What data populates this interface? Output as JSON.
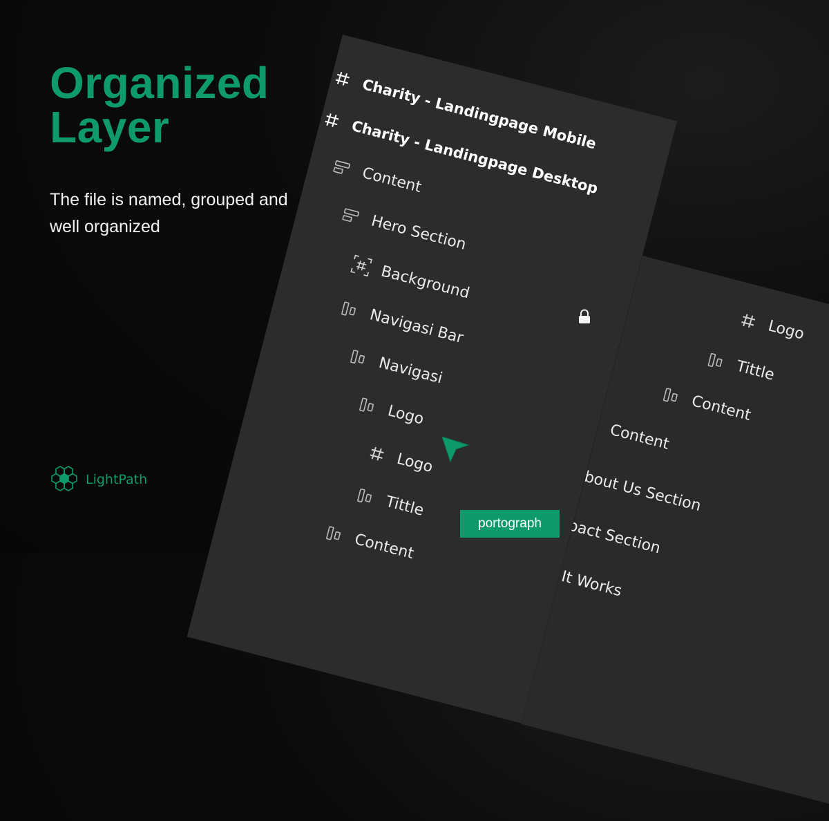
{
  "headline": {
    "line1": "Organized",
    "line2": "Layer"
  },
  "description": "The file is named, grouped and well organized",
  "brand": {
    "name": "LightPath",
    "icon": "hexagon-cluster-icon",
    "color": "#0e9a69"
  },
  "front_panel": {
    "layers": [
      {
        "label": "Charity - Landingpage Mobile",
        "icon": "frame-hash-icon"
      },
      {
        "label": "Charity - Landingpage Desktop",
        "icon": "frame-hash-icon"
      },
      {
        "label": "Content",
        "icon": "auto-layout-vertical-icon"
      },
      {
        "label": "Hero Section",
        "icon": "auto-layout-vertical-icon"
      },
      {
        "label": "Background",
        "icon": "frame-selection-icon"
      },
      {
        "label": "Navigasi Bar",
        "icon": "auto-layout-horizontal-icon"
      },
      {
        "label": "Navigasi",
        "icon": "auto-layout-horizontal-icon"
      },
      {
        "label": "Logo",
        "icon": "auto-layout-horizontal-icon"
      },
      {
        "label": "Logo",
        "icon": "frame-hash-icon"
      },
      {
        "label": "Tittle",
        "icon": "auto-layout-horizontal-icon"
      },
      {
        "label": "Content",
        "icon": "auto-layout-horizontal-icon"
      }
    ]
  },
  "back_panel": {
    "layers": [
      {
        "label": "Logo",
        "icon": "frame-hash-icon"
      },
      {
        "label": "Tittle",
        "icon": "auto-layout-horizontal-icon"
      },
      {
        "label": "Content",
        "icon": "auto-layout-horizontal-icon"
      },
      {
        "label": "Content",
        "icon": "auto-layout-vertical-icon"
      },
      {
        "label": "About Us Section",
        "icon": "auto-layout-vertical-icon"
      },
      {
        "label": "Impact Section",
        "icon": "auto-layout-vertical-icon"
      },
      {
        "label": "How It Works",
        "icon": "auto-layout-vertical-icon"
      }
    ]
  },
  "watermark": "portograph",
  "colors": {
    "accent": "#0e9a69",
    "panel": "#2c2c2c",
    "background": "#080808"
  }
}
